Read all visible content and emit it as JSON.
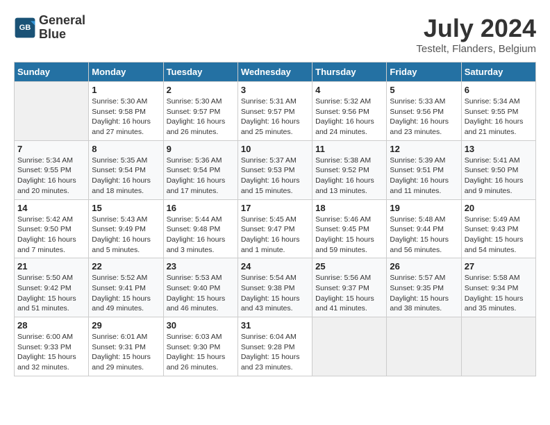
{
  "header": {
    "logo_line1": "General",
    "logo_line2": "Blue",
    "month_year": "July 2024",
    "location": "Testelt, Flanders, Belgium"
  },
  "weekdays": [
    "Sunday",
    "Monday",
    "Tuesday",
    "Wednesday",
    "Thursday",
    "Friday",
    "Saturday"
  ],
  "weeks": [
    [
      {
        "day": "",
        "info": ""
      },
      {
        "day": "1",
        "info": "Sunrise: 5:30 AM\nSunset: 9:58 PM\nDaylight: 16 hours\nand 27 minutes."
      },
      {
        "day": "2",
        "info": "Sunrise: 5:30 AM\nSunset: 9:57 PM\nDaylight: 16 hours\nand 26 minutes."
      },
      {
        "day": "3",
        "info": "Sunrise: 5:31 AM\nSunset: 9:57 PM\nDaylight: 16 hours\nand 25 minutes."
      },
      {
        "day": "4",
        "info": "Sunrise: 5:32 AM\nSunset: 9:56 PM\nDaylight: 16 hours\nand 24 minutes."
      },
      {
        "day": "5",
        "info": "Sunrise: 5:33 AM\nSunset: 9:56 PM\nDaylight: 16 hours\nand 23 minutes."
      },
      {
        "day": "6",
        "info": "Sunrise: 5:34 AM\nSunset: 9:55 PM\nDaylight: 16 hours\nand 21 minutes."
      }
    ],
    [
      {
        "day": "7",
        "info": "Sunrise: 5:34 AM\nSunset: 9:55 PM\nDaylight: 16 hours\nand 20 minutes."
      },
      {
        "day": "8",
        "info": "Sunrise: 5:35 AM\nSunset: 9:54 PM\nDaylight: 16 hours\nand 18 minutes."
      },
      {
        "day": "9",
        "info": "Sunrise: 5:36 AM\nSunset: 9:54 PM\nDaylight: 16 hours\nand 17 minutes."
      },
      {
        "day": "10",
        "info": "Sunrise: 5:37 AM\nSunset: 9:53 PM\nDaylight: 16 hours\nand 15 minutes."
      },
      {
        "day": "11",
        "info": "Sunrise: 5:38 AM\nSunset: 9:52 PM\nDaylight: 16 hours\nand 13 minutes."
      },
      {
        "day": "12",
        "info": "Sunrise: 5:39 AM\nSunset: 9:51 PM\nDaylight: 16 hours\nand 11 minutes."
      },
      {
        "day": "13",
        "info": "Sunrise: 5:41 AM\nSunset: 9:50 PM\nDaylight: 16 hours\nand 9 minutes."
      }
    ],
    [
      {
        "day": "14",
        "info": "Sunrise: 5:42 AM\nSunset: 9:50 PM\nDaylight: 16 hours\nand 7 minutes."
      },
      {
        "day": "15",
        "info": "Sunrise: 5:43 AM\nSunset: 9:49 PM\nDaylight: 16 hours\nand 5 minutes."
      },
      {
        "day": "16",
        "info": "Sunrise: 5:44 AM\nSunset: 9:48 PM\nDaylight: 16 hours\nand 3 minutes."
      },
      {
        "day": "17",
        "info": "Sunrise: 5:45 AM\nSunset: 9:47 PM\nDaylight: 16 hours\nand 1 minute."
      },
      {
        "day": "18",
        "info": "Sunrise: 5:46 AM\nSunset: 9:45 PM\nDaylight: 15 hours\nand 59 minutes."
      },
      {
        "day": "19",
        "info": "Sunrise: 5:48 AM\nSunset: 9:44 PM\nDaylight: 15 hours\nand 56 minutes."
      },
      {
        "day": "20",
        "info": "Sunrise: 5:49 AM\nSunset: 9:43 PM\nDaylight: 15 hours\nand 54 minutes."
      }
    ],
    [
      {
        "day": "21",
        "info": "Sunrise: 5:50 AM\nSunset: 9:42 PM\nDaylight: 15 hours\nand 51 minutes."
      },
      {
        "day": "22",
        "info": "Sunrise: 5:52 AM\nSunset: 9:41 PM\nDaylight: 15 hours\nand 49 minutes."
      },
      {
        "day": "23",
        "info": "Sunrise: 5:53 AM\nSunset: 9:40 PM\nDaylight: 15 hours\nand 46 minutes."
      },
      {
        "day": "24",
        "info": "Sunrise: 5:54 AM\nSunset: 9:38 PM\nDaylight: 15 hours\nand 43 minutes."
      },
      {
        "day": "25",
        "info": "Sunrise: 5:56 AM\nSunset: 9:37 PM\nDaylight: 15 hours\nand 41 minutes."
      },
      {
        "day": "26",
        "info": "Sunrise: 5:57 AM\nSunset: 9:35 PM\nDaylight: 15 hours\nand 38 minutes."
      },
      {
        "day": "27",
        "info": "Sunrise: 5:58 AM\nSunset: 9:34 PM\nDaylight: 15 hours\nand 35 minutes."
      }
    ],
    [
      {
        "day": "28",
        "info": "Sunrise: 6:00 AM\nSunset: 9:33 PM\nDaylight: 15 hours\nand 32 minutes."
      },
      {
        "day": "29",
        "info": "Sunrise: 6:01 AM\nSunset: 9:31 PM\nDaylight: 15 hours\nand 29 minutes."
      },
      {
        "day": "30",
        "info": "Sunrise: 6:03 AM\nSunset: 9:30 PM\nDaylight: 15 hours\nand 26 minutes."
      },
      {
        "day": "31",
        "info": "Sunrise: 6:04 AM\nSunset: 9:28 PM\nDaylight: 15 hours\nand 23 minutes."
      },
      {
        "day": "",
        "info": ""
      },
      {
        "day": "",
        "info": ""
      },
      {
        "day": "",
        "info": ""
      }
    ]
  ]
}
